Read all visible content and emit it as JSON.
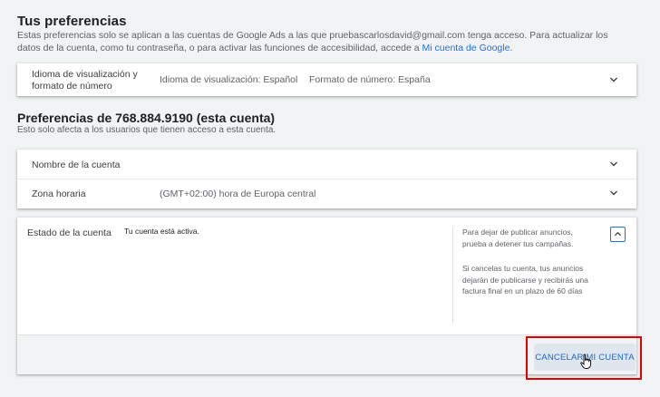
{
  "preferences": {
    "title": "Tus preferencias",
    "description_prefix": "Estas preferencias solo se aplican a las cuentas de Google Ads a las que pruebascarlosdavid@gmail.com tenga acceso. Para actualizar los datos de la cuenta, como tu contraseña, o para activar las funciones de accesibilidad, accede a ",
    "description_link": "Mi cuenta de Google",
    "description_suffix": ".",
    "display_row": {
      "label": "Idioma de visualización y formato de número",
      "language_value": "Idioma de visualización: Español",
      "number_format_value": "Formato de número: España"
    }
  },
  "account": {
    "title": "Preferencias de 768.884.9190 (esta cuenta)",
    "subtitle": "Esto solo afecta a los usuarios que tienen acceso a esta cuenta.",
    "name_row": {
      "label": "Nombre de la cuenta"
    },
    "timezone_row": {
      "label": "Zona horaria",
      "value": "(GMT+02:00) hora de Europa central"
    },
    "status": {
      "label": "Estado de la cuenta",
      "value": "Tu cuenta está activa.",
      "help_1": "Para dejar de publicar anuncios, prueba a detener tus campañas.",
      "help_2": "Si cancelas tu cuenta, tus anuncios dejarán de publicarse y recibirás una factura final en un plazo de 60 días",
      "cancel_button": "CANCELAR MI CUENTA"
    }
  },
  "colors": {
    "link": "#1a73e8",
    "highlight": "#e00000"
  }
}
